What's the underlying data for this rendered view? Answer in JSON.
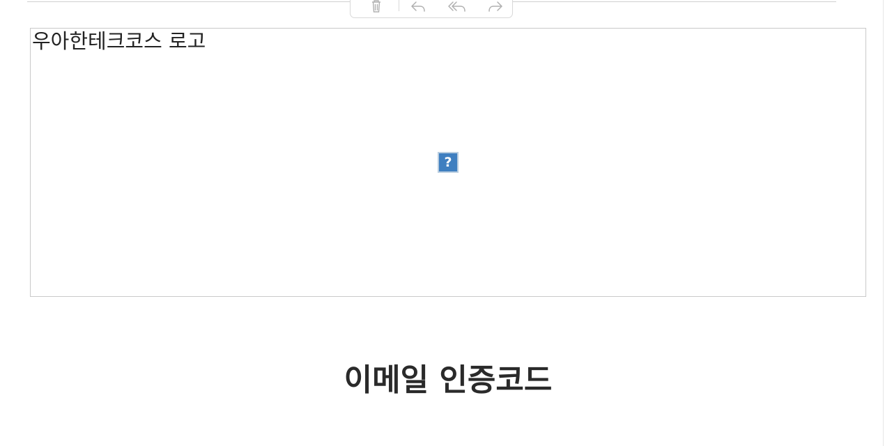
{
  "toolbar": {
    "buttons": [
      {
        "name": "delete",
        "icon": "trash-icon"
      },
      {
        "name": "reply",
        "icon": "reply-icon"
      },
      {
        "name": "reply-all",
        "icon": "reply-all-icon"
      },
      {
        "name": "forward",
        "icon": "forward-icon"
      }
    ],
    "icon_color": "#b0b0b0"
  },
  "email": {
    "logo_alt_text": "우아한테크코스 로고",
    "broken_image_icon": "question-mark-icon",
    "heading": "이메일 인증코드"
  },
  "colors": {
    "broken_icon_fill": "#3f7fc0",
    "heading_text": "#2a2a2a"
  }
}
